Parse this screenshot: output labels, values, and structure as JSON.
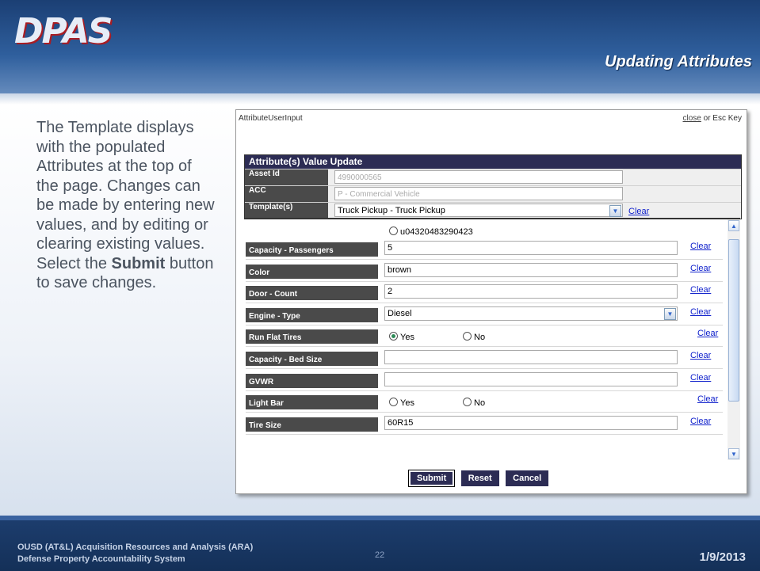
{
  "slide": {
    "logo": "DPAS",
    "title": "Updating Attributes",
    "body_parts": [
      "The Template displays with the populated Attributes at the top of the page.  Changes can be made by entering new values, and by editing or clearing existing values.  Select the ",
      "Submit",
      " button to save changes."
    ]
  },
  "dialog": {
    "title": "AttributeUserInput",
    "close_link": "close",
    "close_suffix": " or Esc Key",
    "header": {
      "caption": "Attribute(s) Value Update",
      "asset_id_label": "Asset Id",
      "asset_id_value": "4990000565",
      "acc_label": "ACC",
      "acc_value": "P - Commercial Vehicle",
      "template_label": "Template(s)",
      "template_value": "Truck Pickup - Truck Pickup",
      "template_clear": "Clear"
    },
    "partial_option": "u04320483290423",
    "rows": [
      {
        "label": "Capacity - Passengers",
        "type": "text",
        "value": "5",
        "clear": "Clear"
      },
      {
        "label": "Color",
        "type": "text",
        "value": "brown",
        "clear": "Clear"
      },
      {
        "label": "Door - Count",
        "type": "text",
        "value": "2",
        "clear": "Clear"
      },
      {
        "label": "Engine - Type",
        "type": "select",
        "value": "Diesel",
        "clear": "Clear"
      },
      {
        "label": "Run Flat Tires",
        "type": "radio",
        "options": [
          "Yes",
          "No"
        ],
        "selected": "Yes",
        "clear": "Clear"
      },
      {
        "label": "Capacity - Bed Size",
        "type": "text",
        "value": "",
        "clear": "Clear"
      },
      {
        "label": "GVWR",
        "type": "text",
        "value": "",
        "clear": "Clear"
      },
      {
        "label": "Light Bar",
        "type": "radio",
        "options": [
          "Yes",
          "No"
        ],
        "selected": "",
        "clear": "Clear"
      },
      {
        "label": "Tire Size",
        "type": "text",
        "value": "60R15",
        "clear": "Clear"
      }
    ],
    "buttons": {
      "submit": "Submit",
      "reset": "Reset",
      "cancel": "Cancel"
    }
  },
  "footer": {
    "org_line1": "OUSD (AT&L) Acquisition Resources and Analysis (ARA)",
    "org_line2": "Defense Property Accountability System",
    "page_number": "22",
    "date": "1/9/2013"
  },
  "colors": {
    "header_blue": "#2f5f9d",
    "dialog_navy": "#2c2c54",
    "label_gray": "#4a4a4a",
    "link_blue": "#1122cc"
  }
}
